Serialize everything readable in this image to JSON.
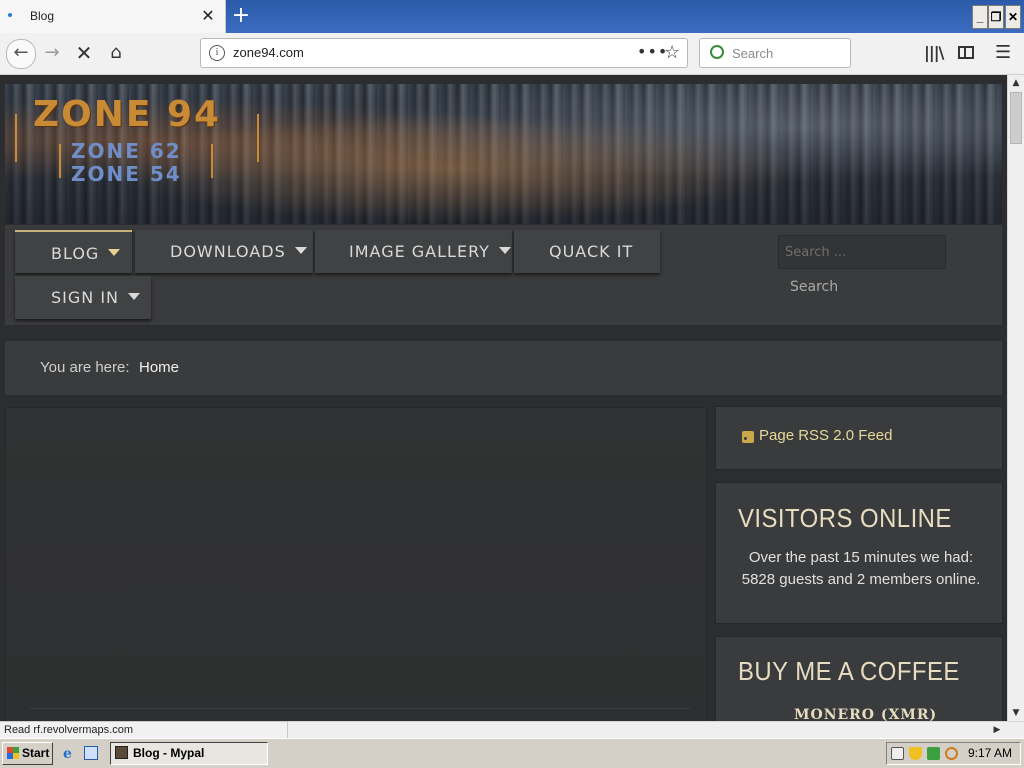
{
  "browser": {
    "tab_title": "Blog",
    "tab_close": "✕",
    "new_tab": "+",
    "window_controls": {
      "minimize": "_",
      "maximize": "❐",
      "close": "✕"
    },
    "url": "zone94.com",
    "url_actions": "•••",
    "search_placeholder": "Search",
    "status_text": "Read rf.revolvermaps.com"
  },
  "site": {
    "logo": {
      "main": "ZONE 94",
      "sub1": "ZONE 62",
      "sub2": "ZONE 54"
    },
    "menu": [
      {
        "label": "BLOG",
        "has_dropdown": true,
        "active": true
      },
      {
        "label": "DOWNLOADS",
        "has_dropdown": true
      },
      {
        "label": "IMAGE GALLERY",
        "has_dropdown": true
      },
      {
        "label": "QUACK IT",
        "has_dropdown": false
      },
      {
        "label": "SIGN IN",
        "has_dropdown": true
      }
    ],
    "search": {
      "placeholder": "Search ...",
      "button": "Search"
    },
    "breadcrumb": {
      "label": "You are here:",
      "home": "Home"
    },
    "sidebar": {
      "rss_link": "Page RSS 2.0 Feed",
      "visitors_title": "VISITORS ONLINE",
      "visitors_text": "Over the past 15 minutes we had: 5828 guests and 2 members online.",
      "coffee_title": "BUY ME A COFFEE",
      "coffee_sub": "MONERO (XMR)"
    },
    "colors": {
      "background": "#2b2d2e",
      "panel": "#3a3b3c",
      "accent": "#e6d99a",
      "heading": "#e8dcc0"
    }
  },
  "taskbar": {
    "start_label": "Start",
    "task_label": "Blog - Mypal",
    "clock": "9:17 AM"
  }
}
